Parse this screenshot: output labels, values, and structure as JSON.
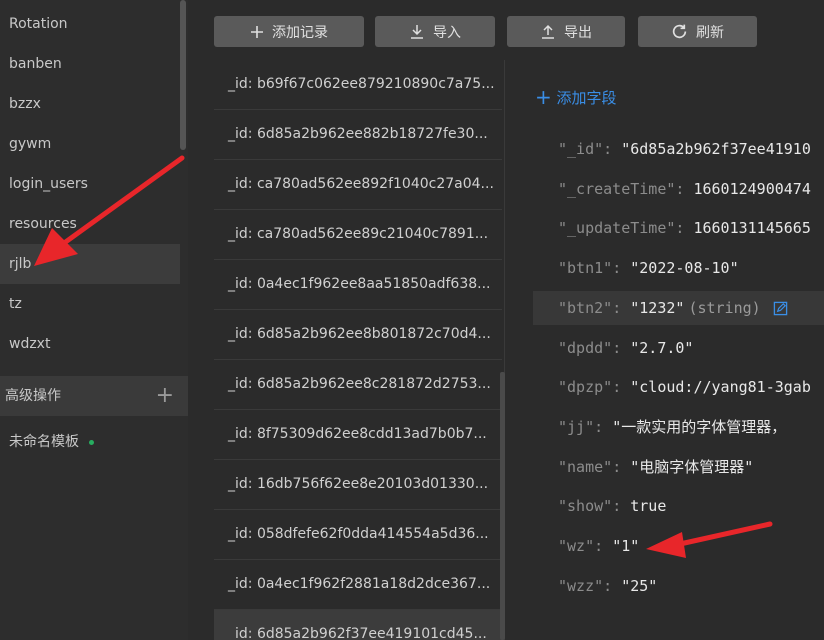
{
  "sidebar": {
    "collections": [
      {
        "label": "Rotation",
        "active": false
      },
      {
        "label": "banben",
        "active": false
      },
      {
        "label": "bzzx",
        "active": false
      },
      {
        "label": "gywm",
        "active": false
      },
      {
        "label": "login_users",
        "active": false
      },
      {
        "label": "resources",
        "active": false
      },
      {
        "label": "rjlb",
        "active": true
      },
      {
        "label": "tz",
        "active": false
      },
      {
        "label": "wdzxt",
        "active": false
      }
    ],
    "advanced_label": "高级操作",
    "template_label": "未命名模板"
  },
  "toolbar": {
    "add_record": "添加记录",
    "import": "导入",
    "export": "导出",
    "refresh": "刷新"
  },
  "records": [
    "_id: b69f67c062ee879210890c7a75...",
    "_id: 6d85a2b962ee882b18727fe30...",
    "_id: ca780ad562ee892f1040c27a04...",
    "_id: ca780ad562ee89c21040c7891...",
    "_id: 0a4ec1f962ee8aa51850adf638...",
    "_id: 6d85a2b962ee8b801872c70d4...",
    "_id: 6d85a2b962ee8c281872d2753...",
    "_id: 8f75309d62ee8cdd13ad7b0b7...",
    "_id: 16db756f62ee8e20103d01330...",
    "_id: 058dfefe62f0dda414554a5d36...",
    "_id: 0a4ec1f962f2881a18d2dce367...",
    "_id: 6d85a2b962f37ee419101cd45..."
  ],
  "active_record_index": 11,
  "detail": {
    "add_field_label": "添加字段",
    "fields": [
      {
        "key": "\"_id\"",
        "value": "\"6d85a2b962f37ee41910"
      },
      {
        "key": "\"_createTime\"",
        "value": "1660124900474"
      },
      {
        "key": "\"_updateTime\"",
        "value": "1660131145665"
      },
      {
        "key": "\"btn1\"",
        "value": "\"2022-08-10\""
      },
      {
        "key": "\"btn2\"",
        "value": "\"1232\"",
        "type_hint": "(string)"
      },
      {
        "key": "\"dpdd\"",
        "value": "\"2.7.0\""
      },
      {
        "key": "\"dpzp\"",
        "value": "\"cloud://yang81-3gab"
      },
      {
        "key": "\"jj\"",
        "value": "\"一款实用的字体管理器，"
      },
      {
        "key": "\"name\"",
        "value": "\"电脑字体管理器\""
      },
      {
        "key": "\"show\"",
        "value": "true"
      },
      {
        "key": "\"wz\"",
        "value": "\"1\""
      },
      {
        "key": "\"wzz\"",
        "value": "\"25\""
      }
    ],
    "colon": ":"
  },
  "colors": {
    "accent": "#3a8ee6",
    "arrow": "#e8262a",
    "status_dot": "#27ae60"
  }
}
